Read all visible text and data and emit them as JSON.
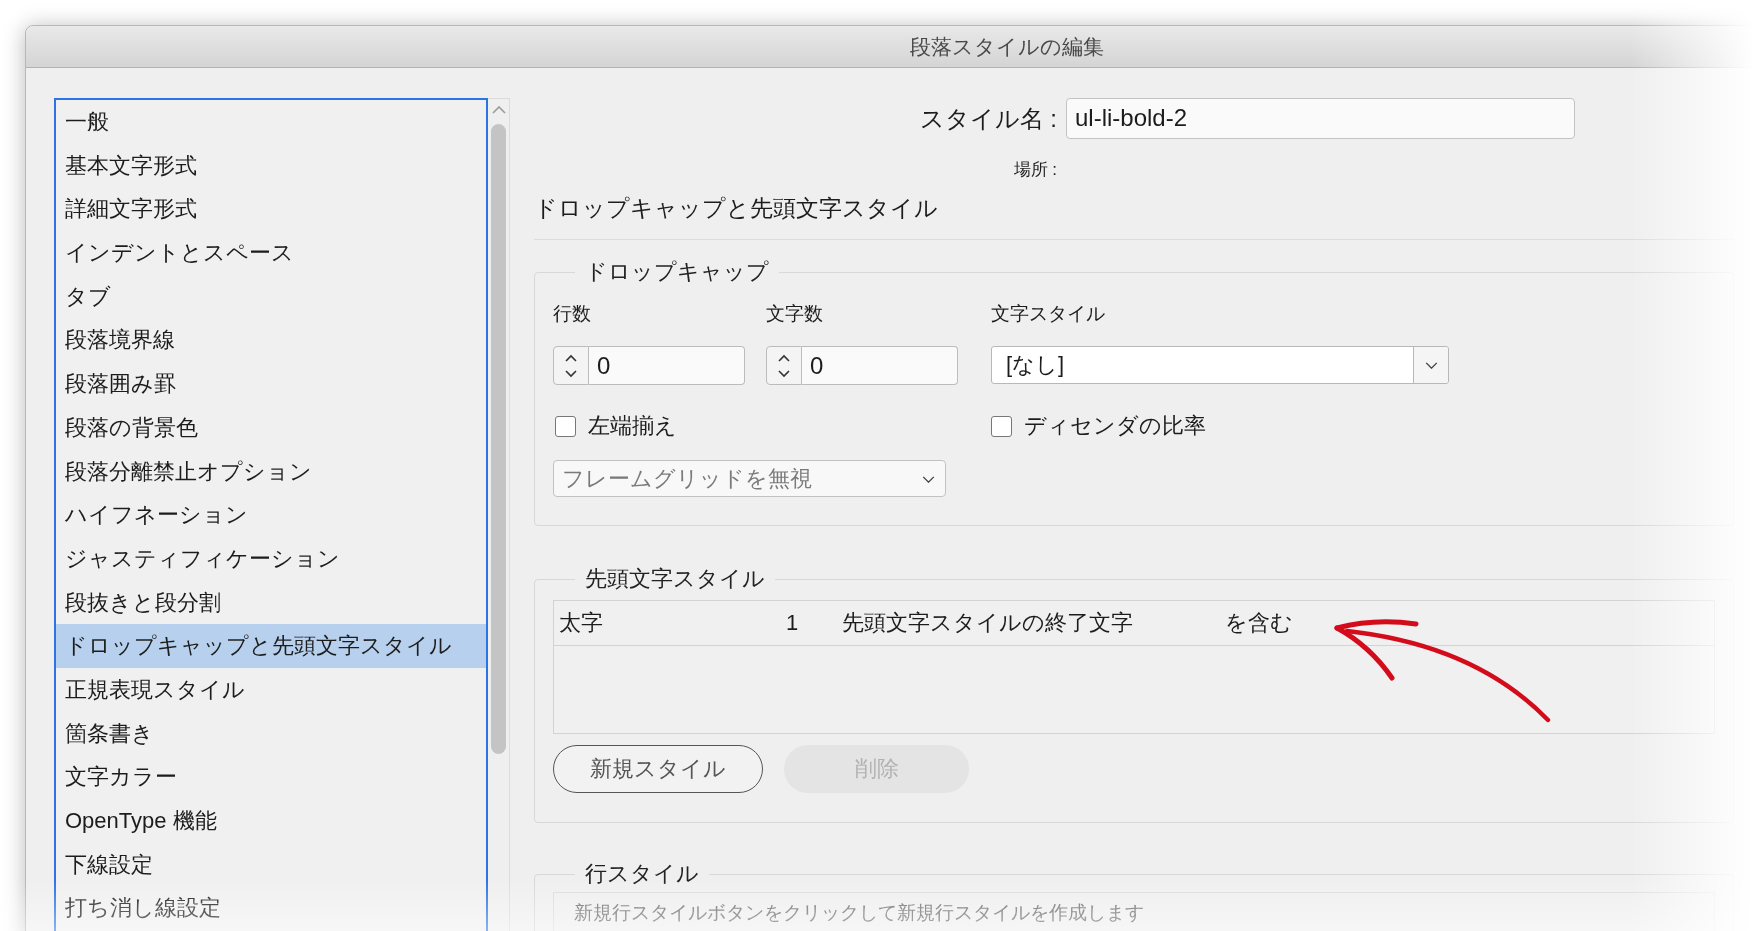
{
  "window": {
    "title": "段落スタイルの編集"
  },
  "sidebar": {
    "items": [
      {
        "label": "一般",
        "selected": false
      },
      {
        "label": "基本文字形式",
        "selected": false
      },
      {
        "label": "詳細文字形式",
        "selected": false
      },
      {
        "label": "インデントとスペース",
        "selected": false
      },
      {
        "label": "タブ",
        "selected": false
      },
      {
        "label": "段落境界線",
        "selected": false
      },
      {
        "label": "段落囲み罫",
        "selected": false
      },
      {
        "label": "段落の背景色",
        "selected": false
      },
      {
        "label": "段落分離禁止オプション",
        "selected": false
      },
      {
        "label": "ハイフネーション",
        "selected": false
      },
      {
        "label": "ジャスティフィケーション",
        "selected": false
      },
      {
        "label": "段抜きと段分割",
        "selected": false
      },
      {
        "label": "ドロップキャップと先頭文字スタイル",
        "selected": true
      },
      {
        "label": "正規表現スタイル",
        "selected": false
      },
      {
        "label": "箇条書き",
        "selected": false
      },
      {
        "label": "文字カラー",
        "selected": false
      },
      {
        "label": "OpenType 機能",
        "selected": false
      },
      {
        "label": "下線設定",
        "selected": false
      },
      {
        "label": "打ち消し線設定",
        "selected": false
      }
    ]
  },
  "style_name": {
    "label": "スタイル名 :",
    "value": "ul-li-bold-2"
  },
  "location": {
    "label": "場所 :"
  },
  "section_title": "ドロップキャップと先頭文字スタイル",
  "drop_cap": {
    "legend": "ドロップキャップ",
    "lines": {
      "label": "行数",
      "value": "0"
    },
    "characters": {
      "label": "文字数",
      "value": "0"
    },
    "character_style": {
      "label": "文字スタイル",
      "value": "[なし]"
    },
    "checkboxes": [
      {
        "label": "左端揃え",
        "checked": false
      },
      {
        "label": "ディセンダの比率",
        "checked": false
      }
    ],
    "frame_grid": {
      "value": "フレームグリッドを無視",
      "disabled": true
    }
  },
  "nested_styles": {
    "legend": "先頭文字スタイル",
    "rows": [
      {
        "cells": [
          "太字",
          "1",
          "先頭文字スタイルの終了文字",
          "を含む"
        ]
      }
    ],
    "buttons": [
      {
        "label": "新規スタイル",
        "disabled": false
      },
      {
        "label": "削除",
        "disabled": true
      }
    ]
  },
  "line_styles": {
    "legend": "行スタイル",
    "empty_hint": "新規行スタイルボタンをクリックして新規行スタイルを作成します"
  }
}
